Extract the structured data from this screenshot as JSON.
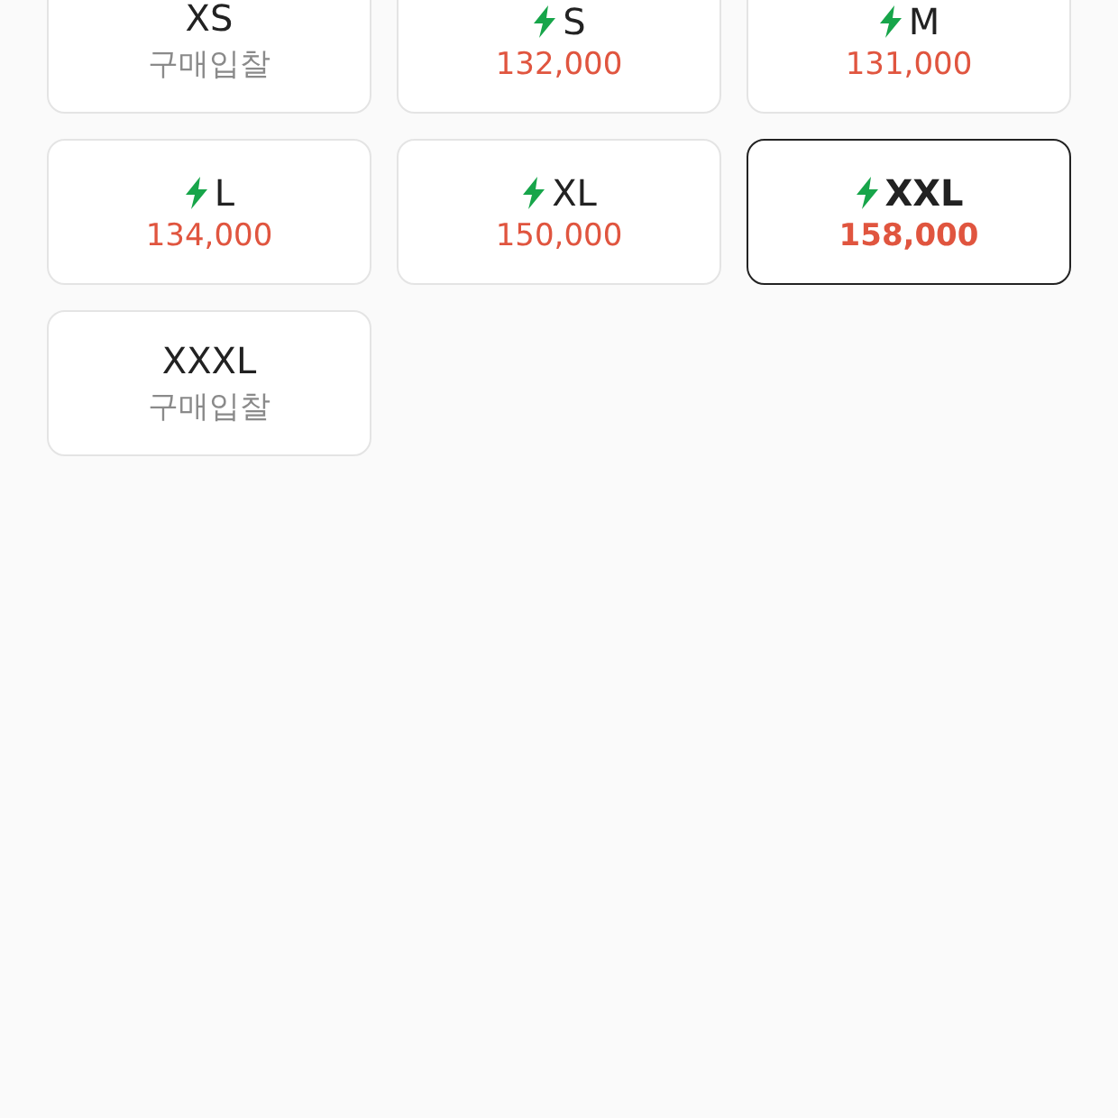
{
  "sizes": [
    {
      "size": "XS",
      "fast": false,
      "selected": false,
      "kind": "bid",
      "price": "구매입찰"
    },
    {
      "size": "S",
      "fast": true,
      "selected": false,
      "kind": "price",
      "price": "132,000"
    },
    {
      "size": "M",
      "fast": true,
      "selected": false,
      "kind": "price",
      "price": "131,000"
    },
    {
      "size": "L",
      "fast": true,
      "selected": false,
      "kind": "price",
      "price": "134,000"
    },
    {
      "size": "XL",
      "fast": true,
      "selected": false,
      "kind": "price",
      "price": "150,000"
    },
    {
      "size": "XXL",
      "fast": true,
      "selected": true,
      "kind": "price",
      "price": "158,000"
    },
    {
      "size": "XXXL",
      "fast": false,
      "selected": false,
      "kind": "bid",
      "price": "구매입찰"
    }
  ]
}
